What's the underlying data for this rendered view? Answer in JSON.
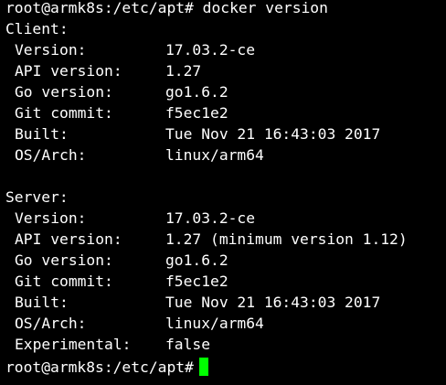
{
  "terminal": {
    "prompt": "root@armk8s:/etc/apt#",
    "command": "docker version",
    "client_header": "Client:",
    "client": [
      {
        "key": "Version:",
        "value": "17.03.2-ce"
      },
      {
        "key": "API version:",
        "value": "1.27"
      },
      {
        "key": "Go version:",
        "value": "go1.6.2"
      },
      {
        "key": "Git commit:",
        "value": "f5ec1e2"
      },
      {
        "key": "Built:",
        "value": "Tue Nov 21 16:43:03 2017"
      },
      {
        "key": "OS/Arch:",
        "value": "linux/arm64"
      }
    ],
    "server_header": "Server:",
    "server": [
      {
        "key": "Version:",
        "value": "17.03.2-ce"
      },
      {
        "key": "API version:",
        "value": "1.27 (minimum version 1.12)"
      },
      {
        "key": "Go version:",
        "value": "go1.6.2"
      },
      {
        "key": "Git commit:",
        "value": "f5ec1e2"
      },
      {
        "key": "Built:",
        "value": "Tue Nov 21 16:43:03 2017"
      },
      {
        "key": "OS/Arch:",
        "value": "linux/arm64"
      },
      {
        "key": "Experimental:",
        "value": "false"
      }
    ],
    "cursor_color": "#00ff00",
    "background_color": "#000000",
    "text_color": "#ffffff"
  }
}
